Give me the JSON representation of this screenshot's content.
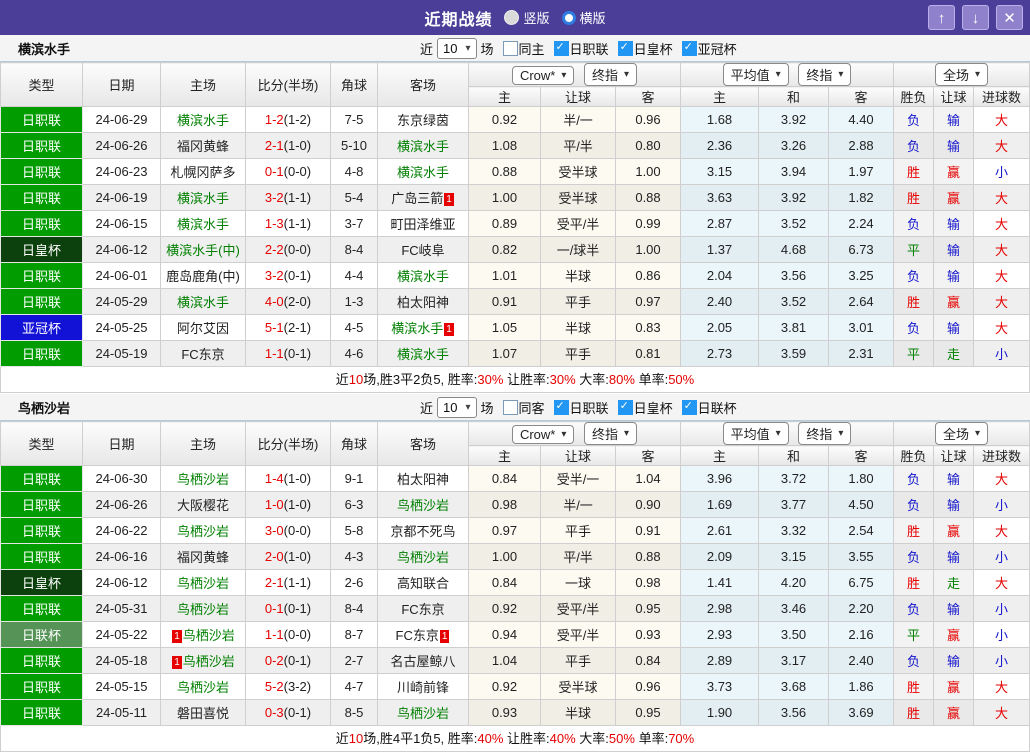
{
  "titlebar": {
    "title": "近期战绩",
    "radios": [
      {
        "label": "竖版",
        "selected": false
      },
      {
        "label": "横版",
        "selected": true
      }
    ],
    "icons": {
      "up": "↑",
      "down": "↓",
      "close": "✕"
    }
  },
  "colors": {
    "titlebar_purple": "#4A3E99",
    "accent_red": "#E60000",
    "accent_blue": "#1414CC",
    "accent_green": "#008000",
    "checkbox_blue": "#2196F3"
  },
  "type_colors": {
    "日职联": "#009C00",
    "日皇杯": "#0C400C",
    "亚冠杯": "#1212D6",
    "日联杯": "#569356"
  },
  "table_header": {
    "type": "类型",
    "date": "日期",
    "home": "主场",
    "score": "比分(半场)",
    "corner": "角球",
    "away": "客场",
    "crow_select": "Crow*",
    "crow_stage": "终指",
    "avg_select": "平均值",
    "avg_stage": "终指",
    "scope_select": "全场",
    "crow_cols": [
      "主",
      "让球",
      "客"
    ],
    "avg_cols": [
      "主",
      "和",
      "客"
    ],
    "result_cols": [
      "胜负",
      "让球",
      "进球数"
    ]
  },
  "sections": [
    {
      "team": "横滨水手",
      "filter": {
        "near_label": "近",
        "count": "10",
        "games_label": "场",
        "same_label": "同主",
        "same_checked": false,
        "leagues": [
          {
            "label": "日职联",
            "checked": true
          },
          {
            "label": "日皇杯",
            "checked": true
          },
          {
            "label": "亚冠杯",
            "checked": true
          }
        ]
      },
      "rows": [
        {
          "type": "日职联",
          "date": "24-06-29",
          "home": "横滨水手",
          "hh": true,
          "hb": "",
          "score": "1-2",
          "half": "(1-2)",
          "corner": "7-5",
          "away": "东京绿茵",
          "ah": false,
          "ab": "",
          "crow": [
            "0.92",
            "半/一",
            "0.96"
          ],
          "avg": [
            "1.68",
            "3.92",
            "4.40"
          ],
          "res": [
            [
              "负",
              "l"
            ],
            [
              "输",
              "l"
            ],
            [
              "大",
              "w"
            ]
          ]
        },
        {
          "type": "日职联",
          "date": "24-06-26",
          "home": "福冈黄蜂",
          "hh": false,
          "hb": "",
          "score": "2-1",
          "half": "(1-0)",
          "corner": "5-10",
          "away": "横滨水手",
          "ah": true,
          "ab": "",
          "crow": [
            "1.08",
            "平/半",
            "0.80"
          ],
          "avg": [
            "2.36",
            "3.26",
            "2.88"
          ],
          "res": [
            [
              "负",
              "l"
            ],
            [
              "输",
              "l"
            ],
            [
              "大",
              "w"
            ]
          ]
        },
        {
          "type": "日职联",
          "date": "24-06-23",
          "home": "札幌冈萨多",
          "hh": false,
          "hb": "",
          "score": "0-1",
          "half": "(0-0)",
          "corner": "4-8",
          "away": "横滨水手",
          "ah": true,
          "ab": "",
          "crow": [
            "0.88",
            "受半球",
            "1.00"
          ],
          "avg": [
            "3.15",
            "3.94",
            "1.97"
          ],
          "res": [
            [
              "胜",
              "w"
            ],
            [
              "赢",
              "w"
            ],
            [
              "小",
              "l"
            ]
          ]
        },
        {
          "type": "日职联",
          "date": "24-06-19",
          "home": "横滨水手",
          "hh": true,
          "hb": "",
          "score": "3-2",
          "half": "(1-1)",
          "corner": "5-4",
          "away": "广岛三箭",
          "ah": false,
          "ab": "1",
          "crow": [
            "1.00",
            "受半球",
            "0.88"
          ],
          "avg": [
            "3.63",
            "3.92",
            "1.82"
          ],
          "res": [
            [
              "胜",
              "w"
            ],
            [
              "赢",
              "w"
            ],
            [
              "大",
              "w"
            ]
          ]
        },
        {
          "type": "日职联",
          "date": "24-06-15",
          "home": "横滨水手",
          "hh": true,
          "hb": "",
          "score": "1-3",
          "half": "(1-1)",
          "corner": "3-7",
          "away": "町田泽维亚",
          "ah": false,
          "ab": "",
          "crow": [
            "0.89",
            "受平/半",
            "0.99"
          ],
          "avg": [
            "2.87",
            "3.52",
            "2.24"
          ],
          "res": [
            [
              "负",
              "l"
            ],
            [
              "输",
              "l"
            ],
            [
              "大",
              "w"
            ]
          ]
        },
        {
          "type": "日皇杯",
          "date": "24-06-12",
          "home": "横滨水手(中)",
          "hh": true,
          "hb": "",
          "score": "2-2",
          "half": "(0-0)",
          "corner": "8-4",
          "away": "FC岐阜",
          "ah": false,
          "ab": "",
          "crow": [
            "0.82",
            "一/球半",
            "1.00"
          ],
          "avg": [
            "1.37",
            "4.68",
            "6.73"
          ],
          "res": [
            [
              "平",
              "d"
            ],
            [
              "输",
              "l"
            ],
            [
              "大",
              "w"
            ]
          ]
        },
        {
          "type": "日职联",
          "date": "24-06-01",
          "home": "鹿岛鹿角(中)",
          "hh": false,
          "hb": "",
          "score": "3-2",
          "half": "(0-1)",
          "corner": "4-4",
          "away": "横滨水手",
          "ah": true,
          "ab": "",
          "crow": [
            "1.01",
            "半球",
            "0.86"
          ],
          "avg": [
            "2.04",
            "3.56",
            "3.25"
          ],
          "res": [
            [
              "负",
              "l"
            ],
            [
              "输",
              "l"
            ],
            [
              "大",
              "w"
            ]
          ]
        },
        {
          "type": "日职联",
          "date": "24-05-29",
          "home": "横滨水手",
          "hh": true,
          "hb": "",
          "score": "4-0",
          "half": "(2-0)",
          "corner": "1-3",
          "away": "柏太阳神",
          "ah": false,
          "ab": "",
          "crow": [
            "0.91",
            "平手",
            "0.97"
          ],
          "avg": [
            "2.40",
            "3.52",
            "2.64"
          ],
          "res": [
            [
              "胜",
              "w"
            ],
            [
              "赢",
              "w"
            ],
            [
              "大",
              "w"
            ]
          ]
        },
        {
          "type": "亚冠杯",
          "date": "24-05-25",
          "home": "阿尔艾因",
          "hh": false,
          "hb": "",
          "score": "5-1",
          "half": "(2-1)",
          "corner": "4-5",
          "away": "横滨水手",
          "ah": true,
          "ab": "1",
          "crow": [
            "1.05",
            "半球",
            "0.83"
          ],
          "avg": [
            "2.05",
            "3.81",
            "3.01"
          ],
          "res": [
            [
              "负",
              "l"
            ],
            [
              "输",
              "l"
            ],
            [
              "大",
              "w"
            ]
          ]
        },
        {
          "type": "日职联",
          "date": "24-05-19",
          "home": "FC东京",
          "hh": false,
          "hb": "",
          "score": "1-1",
          "half": "(0-1)",
          "corner": "4-6",
          "away": "横滨水手",
          "ah": true,
          "ab": "",
          "crow": [
            "1.07",
            "平手",
            "0.81"
          ],
          "avg": [
            "2.73",
            "3.59",
            "2.31"
          ],
          "res": [
            [
              "平",
              "d"
            ],
            [
              "走",
              "d"
            ],
            [
              "小",
              "l"
            ]
          ]
        }
      ],
      "summary": [
        {
          "t": "近"
        },
        {
          "t": "10",
          "red": true
        },
        {
          "t": "场,胜3平2负5, 胜率:"
        },
        {
          "t": "30%",
          "red": true
        },
        {
          "t": " 让胜率:"
        },
        {
          "t": "30%",
          "red": true
        },
        {
          "t": " 大率:"
        },
        {
          "t": "80%",
          "red": true
        },
        {
          "t": " 单率:"
        },
        {
          "t": "50%",
          "red": true
        }
      ]
    },
    {
      "team": "鸟栖沙岩",
      "filter": {
        "near_label": "近",
        "count": "10",
        "games_label": "场",
        "same_label": "同客",
        "same_checked": false,
        "leagues": [
          {
            "label": "日职联",
            "checked": true
          },
          {
            "label": "日皇杯",
            "checked": true
          },
          {
            "label": "日联杯",
            "checked": true
          }
        ]
      },
      "rows": [
        {
          "type": "日职联",
          "date": "24-06-30",
          "home": "鸟栖沙岩",
          "hh": true,
          "hb": "",
          "score": "1-4",
          "half": "(1-0)",
          "corner": "9-1",
          "away": "柏太阳神",
          "ah": false,
          "ab": "",
          "crow": [
            "0.84",
            "受半/一",
            "1.04"
          ],
          "avg": [
            "3.96",
            "3.72",
            "1.80"
          ],
          "res": [
            [
              "负",
              "l"
            ],
            [
              "输",
              "l"
            ],
            [
              "大",
              "w"
            ]
          ]
        },
        {
          "type": "日职联",
          "date": "24-06-26",
          "home": "大阪樱花",
          "hh": false,
          "hb": "",
          "score": "1-0",
          "half": "(1-0)",
          "corner": "6-3",
          "away": "鸟栖沙岩",
          "ah": true,
          "ab": "",
          "crow": [
            "0.98",
            "半/一",
            "0.90"
          ],
          "avg": [
            "1.69",
            "3.77",
            "4.50"
          ],
          "res": [
            [
              "负",
              "l"
            ],
            [
              "输",
              "l"
            ],
            [
              "小",
              "l"
            ]
          ]
        },
        {
          "type": "日职联",
          "date": "24-06-22",
          "home": "鸟栖沙岩",
          "hh": true,
          "hb": "",
          "score": "3-0",
          "half": "(0-0)",
          "corner": "5-8",
          "away": "京都不死鸟",
          "ah": false,
          "ab": "",
          "crow": [
            "0.97",
            "平手",
            "0.91"
          ],
          "avg": [
            "2.61",
            "3.32",
            "2.54"
          ],
          "res": [
            [
              "胜",
              "w"
            ],
            [
              "赢",
              "w"
            ],
            [
              "大",
              "w"
            ]
          ]
        },
        {
          "type": "日职联",
          "date": "24-06-16",
          "home": "福冈黄蜂",
          "hh": false,
          "hb": "",
          "score": "2-0",
          "half": "(1-0)",
          "corner": "4-3",
          "away": "鸟栖沙岩",
          "ah": true,
          "ab": "",
          "crow": [
            "1.00",
            "平/半",
            "0.88"
          ],
          "avg": [
            "2.09",
            "3.15",
            "3.55"
          ],
          "res": [
            [
              "负",
              "l"
            ],
            [
              "输",
              "l"
            ],
            [
              "小",
              "l"
            ]
          ]
        },
        {
          "type": "日皇杯",
          "date": "24-06-12",
          "home": "鸟栖沙岩",
          "hh": true,
          "hb": "",
          "score": "2-1",
          "half": "(1-1)",
          "corner": "2-6",
          "away": "高知联合",
          "ah": false,
          "ab": "",
          "crow": [
            "0.84",
            "一球",
            "0.98"
          ],
          "avg": [
            "1.41",
            "4.20",
            "6.75"
          ],
          "res": [
            [
              "胜",
              "w"
            ],
            [
              "走",
              "d"
            ],
            [
              "大",
              "w"
            ]
          ]
        },
        {
          "type": "日职联",
          "date": "24-05-31",
          "home": "鸟栖沙岩",
          "hh": true,
          "hb": "",
          "score": "0-1",
          "half": "(0-1)",
          "corner": "8-4",
          "away": "FC东京",
          "ah": false,
          "ab": "",
          "crow": [
            "0.92",
            "受平/半",
            "0.95"
          ],
          "avg": [
            "2.98",
            "3.46",
            "2.20"
          ],
          "res": [
            [
              "负",
              "l"
            ],
            [
              "输",
              "l"
            ],
            [
              "小",
              "l"
            ]
          ]
        },
        {
          "type": "日联杯",
          "date": "24-05-22",
          "home": "鸟栖沙岩",
          "hh": true,
          "hb": "1",
          "score": "1-1",
          "half": "(0-0)",
          "corner": "8-7",
          "away": "FC东京",
          "ah": false,
          "ab": "1",
          "crow": [
            "0.94",
            "受平/半",
            "0.93"
          ],
          "avg": [
            "2.93",
            "3.50",
            "2.16"
          ],
          "res": [
            [
              "平",
              "d"
            ],
            [
              "赢",
              "w"
            ],
            [
              "小",
              "l"
            ]
          ]
        },
        {
          "type": "日职联",
          "date": "24-05-18",
          "home": "鸟栖沙岩",
          "hh": true,
          "hb": "1",
          "score": "0-2",
          "half": "(0-1)",
          "corner": "2-7",
          "away": "名古屋鲸八",
          "ah": false,
          "ab": "",
          "crow": [
            "1.04",
            "平手",
            "0.84"
          ],
          "avg": [
            "2.89",
            "3.17",
            "2.40"
          ],
          "res": [
            [
              "负",
              "l"
            ],
            [
              "输",
              "l"
            ],
            [
              "小",
              "l"
            ]
          ]
        },
        {
          "type": "日职联",
          "date": "24-05-15",
          "home": "鸟栖沙岩",
          "hh": true,
          "hb": "",
          "score": "5-2",
          "half": "(3-2)",
          "corner": "4-7",
          "away": "川崎前锋",
          "ah": false,
          "ab": "",
          "crow": [
            "0.92",
            "受半球",
            "0.96"
          ],
          "avg": [
            "3.73",
            "3.68",
            "1.86"
          ],
          "res": [
            [
              "胜",
              "w"
            ],
            [
              "赢",
              "w"
            ],
            [
              "大",
              "w"
            ]
          ]
        },
        {
          "type": "日职联",
          "date": "24-05-11",
          "home": "磐田喜悦",
          "hh": false,
          "hb": "",
          "score": "0-3",
          "half": "(0-1)",
          "corner": "8-5",
          "away": "鸟栖沙岩",
          "ah": true,
          "ab": "",
          "crow": [
            "0.93",
            "半球",
            "0.95"
          ],
          "avg": [
            "1.90",
            "3.56",
            "3.69"
          ],
          "res": [
            [
              "胜",
              "w"
            ],
            [
              "赢",
              "w"
            ],
            [
              "大",
              "w"
            ]
          ]
        }
      ],
      "summary": [
        {
          "t": "近"
        },
        {
          "t": "10",
          "red": true
        },
        {
          "t": "场,胜4平1负5, 胜率:"
        },
        {
          "t": "40%",
          "red": true
        },
        {
          "t": " 让胜率:"
        },
        {
          "t": "40%",
          "red": true
        },
        {
          "t": " 大率:"
        },
        {
          "t": "50%",
          "red": true
        },
        {
          "t": " 单率:"
        },
        {
          "t": "70%",
          "red": true
        }
      ]
    }
  ]
}
